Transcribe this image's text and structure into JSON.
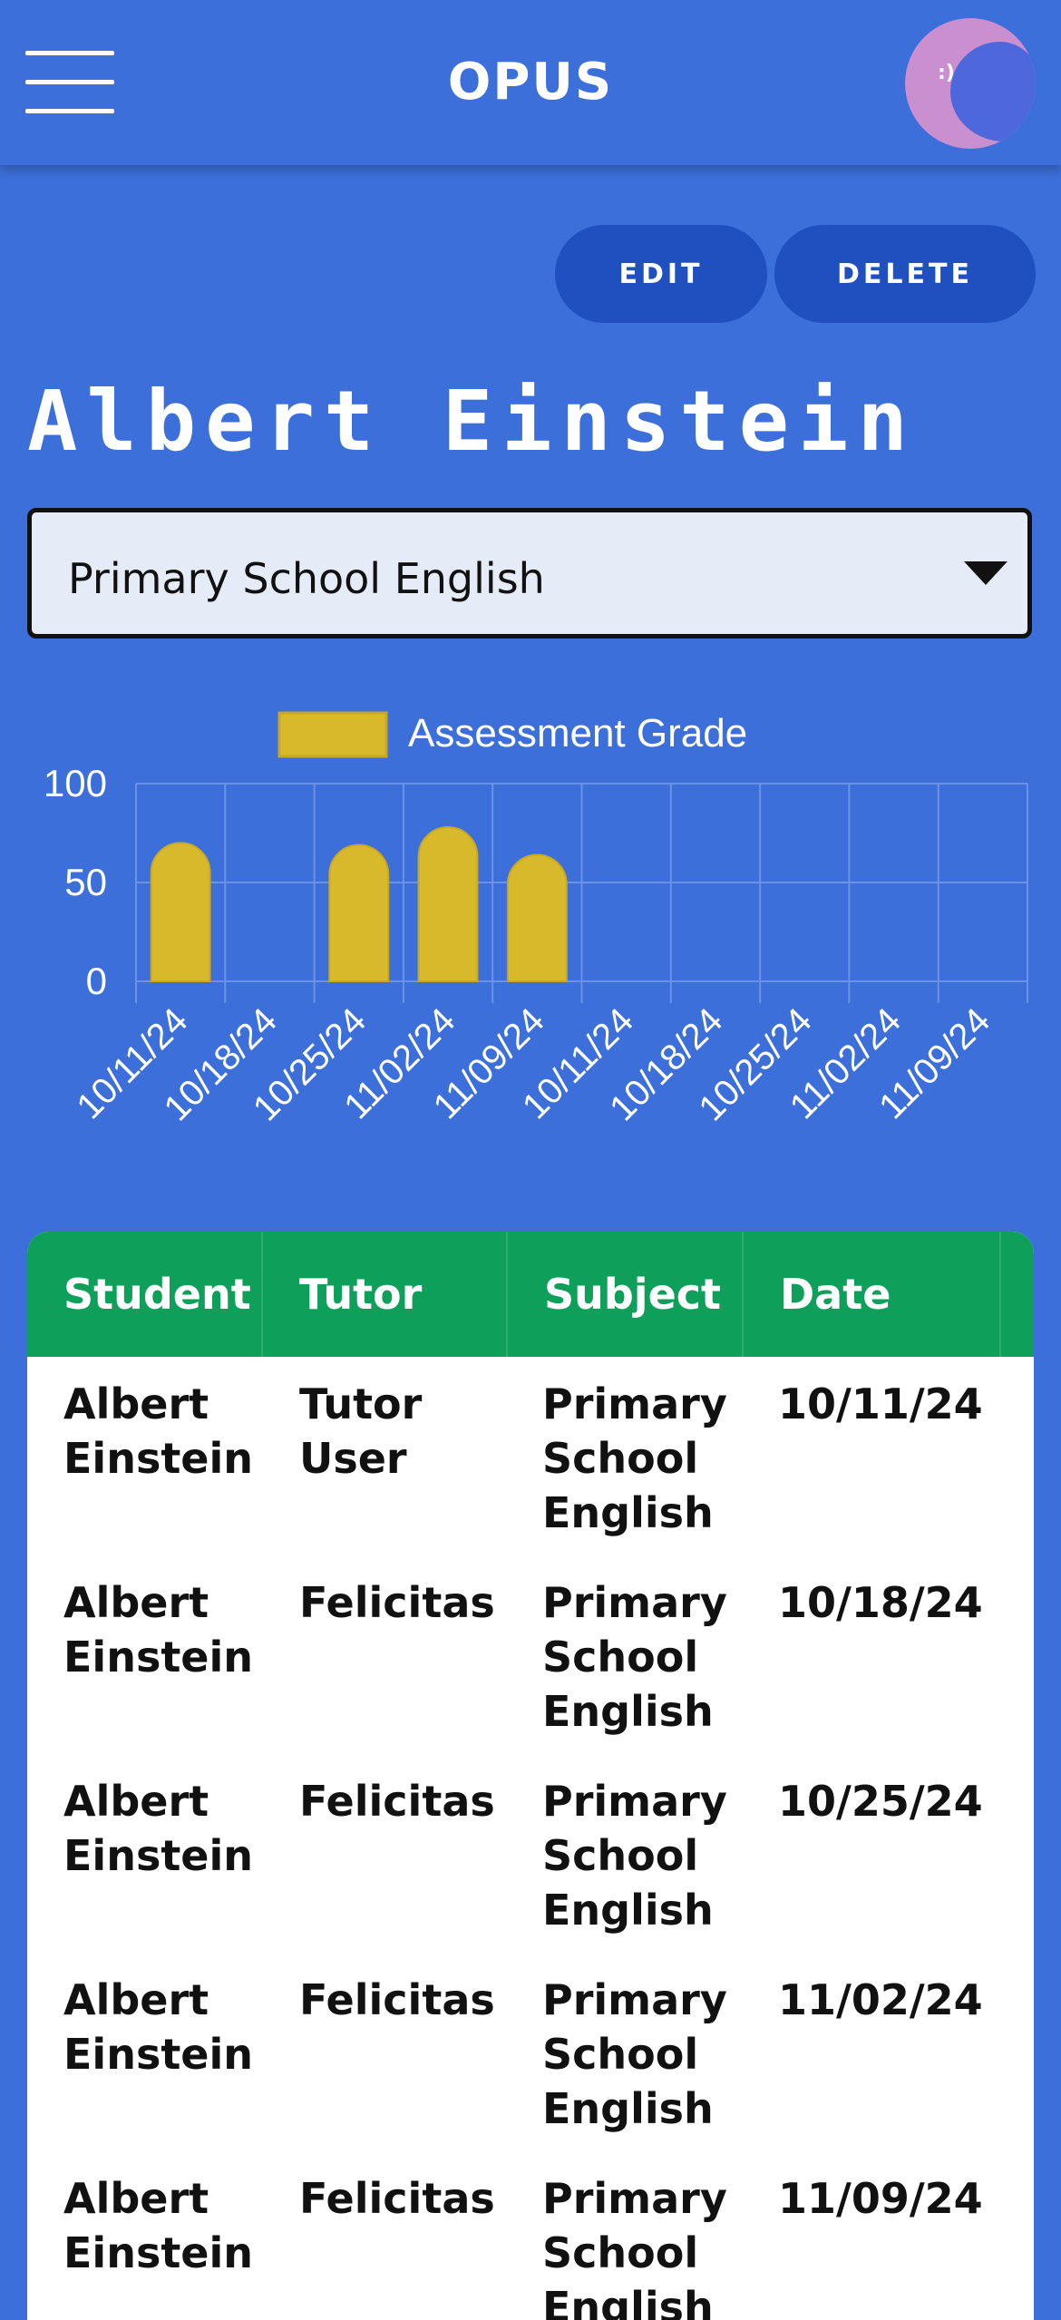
{
  "header": {
    "logo": "OPUS",
    "menu_icon": "hamburger-menu-icon",
    "avatar_icon": "profile-avatar"
  },
  "actions": {
    "edit_label": "EDIT",
    "delete_label": "DELETE"
  },
  "student": {
    "name": "Albert Einstein"
  },
  "subject_select": {
    "value": "Primary School English"
  },
  "colors": {
    "background": "#3c6fd9",
    "bar": "#d8b92c",
    "table_header": "#0ea05a",
    "button": "#2050c0"
  },
  "chart_data": {
    "type": "bar",
    "categories": [
      "10/11/24",
      "10/18/24",
      "10/25/24",
      "11/02/24",
      "11/09/24",
      "10/11/24",
      "10/18/24",
      "10/25/24",
      "11/02/24",
      "11/09/24"
    ],
    "series": [
      {
        "name": "Assessment Grade",
        "values": [
          70,
          null,
          69,
          78,
          64,
          null,
          null,
          null,
          null,
          null
        ]
      }
    ],
    "y_ticks": [
      0,
      50,
      100
    ],
    "ylim": [
      0,
      100
    ],
    "legend": "top",
    "grid": true
  },
  "table": {
    "columns": [
      "Student",
      "Tutor",
      "Subject",
      "Date"
    ],
    "rows": [
      {
        "student": [
          "Albert",
          "Einstein"
        ],
        "tutor": [
          "Tutor",
          "User"
        ],
        "subject": [
          "Primary",
          "School",
          "English"
        ],
        "date": "10/11/24"
      },
      {
        "student": [
          "Albert",
          "Einstein"
        ],
        "tutor": [
          "Felicitas"
        ],
        "subject": [
          "Primary",
          "School",
          "English"
        ],
        "date": "10/18/24"
      },
      {
        "student": [
          "Albert",
          "Einstein"
        ],
        "tutor": [
          "Felicitas"
        ],
        "subject": [
          "Primary",
          "School",
          "English"
        ],
        "date": "10/25/24"
      },
      {
        "student": [
          "Albert",
          "Einstein"
        ],
        "tutor": [
          "Felicitas"
        ],
        "subject": [
          "Primary",
          "School",
          "English"
        ],
        "date": "11/02/24"
      },
      {
        "student": [
          "Albert",
          "Einstein"
        ],
        "tutor": [
          "Felicitas"
        ],
        "subject": [
          "Primary",
          "School",
          "English"
        ],
        "date": "11/09/24"
      }
    ]
  }
}
